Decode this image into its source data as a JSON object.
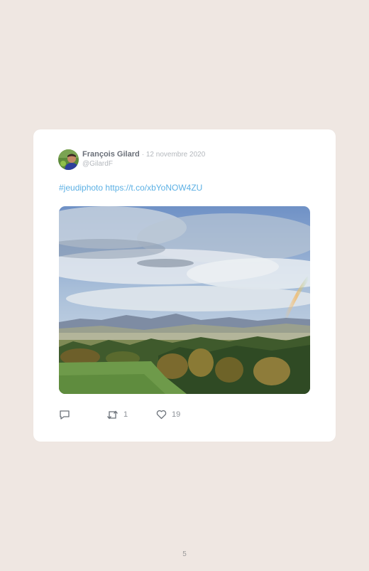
{
  "tweet": {
    "author_name": "François Gilard",
    "date": "12 novembre 2020",
    "handle": "@GilardF",
    "hashtag": "#jeudiphoto",
    "link": "https://t.co/xbYoNOW4ZU"
  },
  "actions": {
    "reply_icon": "reply-icon",
    "retweet_icon": "retweet-icon",
    "retweet_count": "1",
    "like_icon": "heart-icon",
    "like_count": "19"
  },
  "colors": {
    "page_background": "#efe7e2",
    "card_background": "#ffffff",
    "link_color": "#5cb0e4",
    "muted_text": "#b4b8bd"
  },
  "page": {
    "number": "5"
  }
}
